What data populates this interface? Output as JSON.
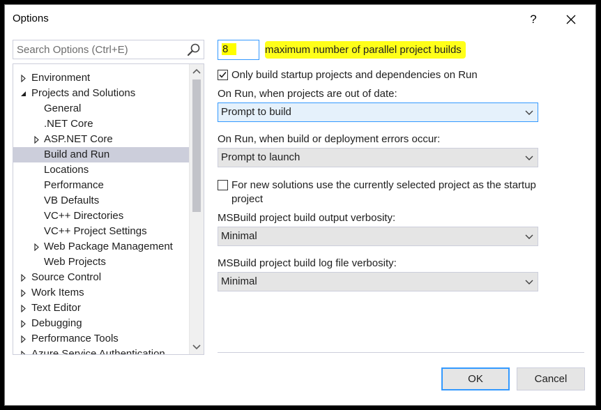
{
  "window": {
    "title": "Options",
    "help_glyph": "?",
    "close_glyph": "✕"
  },
  "search": {
    "placeholder": "Search Options (Ctrl+E)"
  },
  "tree": {
    "items": [
      {
        "label": "Environment",
        "expander": "collapsed",
        "level": 0
      },
      {
        "label": "Projects and Solutions",
        "expander": "expanded",
        "level": 0
      },
      {
        "label": "General",
        "expander": "none",
        "level": 1
      },
      {
        "label": ".NET Core",
        "expander": "none",
        "level": 1
      },
      {
        "label": "ASP.NET Core",
        "expander": "collapsed",
        "level": 1
      },
      {
        "label": "Build and Run",
        "expander": "none",
        "level": 1,
        "selected": true
      },
      {
        "label": "Locations",
        "expander": "none",
        "level": 1
      },
      {
        "label": "Performance",
        "expander": "none",
        "level": 1
      },
      {
        "label": "VB Defaults",
        "expander": "none",
        "level": 1
      },
      {
        "label": "VC++ Directories",
        "expander": "none",
        "level": 1
      },
      {
        "label": "VC++ Project Settings",
        "expander": "none",
        "level": 1
      },
      {
        "label": "Web Package Management",
        "expander": "collapsed",
        "level": 1
      },
      {
        "label": "Web Projects",
        "expander": "none",
        "level": 1
      },
      {
        "label": "Source Control",
        "expander": "collapsed",
        "level": 0
      },
      {
        "label": "Work Items",
        "expander": "collapsed",
        "level": 0
      },
      {
        "label": "Text Editor",
        "expander": "collapsed",
        "level": 0
      },
      {
        "label": "Debugging",
        "expander": "collapsed",
        "level": 0
      },
      {
        "label": "Performance Tools",
        "expander": "collapsed",
        "level": 0
      },
      {
        "label": "Azure Service Authentication",
        "expander": "collapsed",
        "level": 0
      }
    ]
  },
  "settings": {
    "parallel_builds_value": "8",
    "parallel_builds_label": "maximum number of parallel project builds",
    "only_startup_label": "Only build startup projects and dependencies on Run",
    "only_startup_checked": true,
    "out_of_date_label": "On Run, when projects are out of date:",
    "out_of_date_value": "Prompt to build",
    "errors_label": "On Run, when build or deployment errors occur:",
    "errors_value": "Prompt to launch",
    "new_solutions_label_line1": "For new solutions use the currently selected project as the startup",
    "new_solutions_label_line2": "project",
    "new_solutions_checked": false,
    "output_verbosity_label": "MSBuild project build output verbosity:",
    "output_verbosity_value": "Minimal",
    "log_verbosity_label": "MSBuild project build log file verbosity:",
    "log_verbosity_value": "Minimal"
  },
  "buttons": {
    "ok": "OK",
    "cancel": "Cancel"
  },
  "colors": {
    "accent": "#3399ff",
    "highlight": "#ffff00",
    "selection": "#cccedb"
  }
}
